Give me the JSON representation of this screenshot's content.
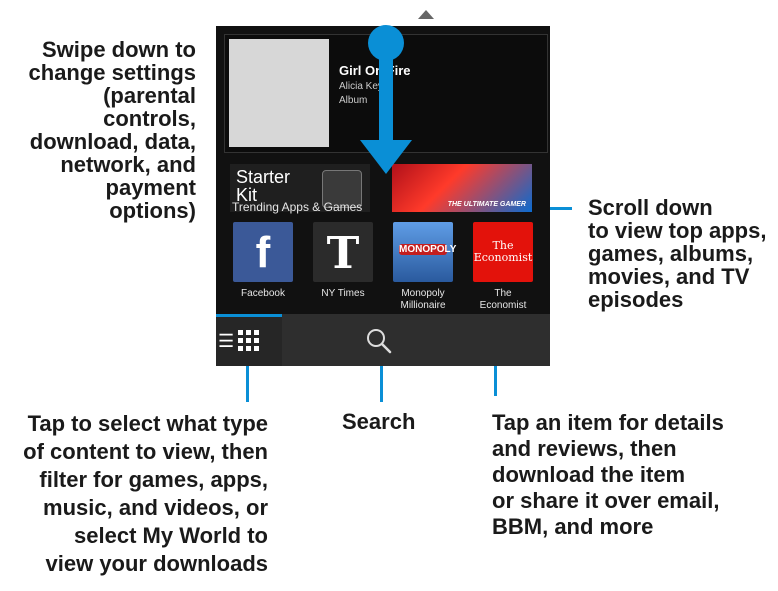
{
  "callouts": {
    "swipe": "Swipe down to\nchange settings\n(parental\ncontrols,\ndownload, data,\nnetwork, and\npayment\noptions)",
    "scroll": "Scroll down\nto view top apps,\ngames, albums,\nmovies, and TV\nepisodes",
    "tap_type": "Tap to select what type\nof content to view, then\nfilter for games, apps,\nmusic, and videos, or\nselect My World to\nview your downloads",
    "search": "Search",
    "tap_item": "Tap an item for details\nand reviews, then\ndownload the item\nor share it over email,\nBBM, and more"
  },
  "featured": {
    "title": "Girl On Fire",
    "artist": "Alicia Keys",
    "kind": "Album"
  },
  "banners": {
    "starter": "Starter\nKit",
    "racer": "THE ULTIMATE GAMER"
  },
  "section_title": "Trending Apps & Games",
  "apps": [
    {
      "name": "Facebook",
      "glyph": "f"
    },
    {
      "name": "NY Times",
      "glyph": "T"
    },
    {
      "name": "Monopoly\nMillionaire",
      "glyph": "MONOPOLY"
    },
    {
      "name": "The\nEconomist",
      "glyph": "The\nEconomist"
    }
  ],
  "colors": {
    "accent": "#0a8fd6",
    "phone_bg": "#111111"
  },
  "icons": {
    "grid": "grid-icon",
    "list": "list-icon",
    "search": "search-icon"
  }
}
